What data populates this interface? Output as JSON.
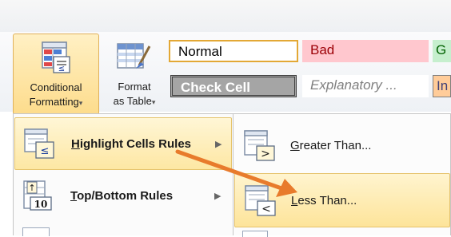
{
  "ribbon": {
    "conditional_formatting": {
      "label_line1": "Conditional",
      "label_line2": "Formatting",
      "dropdown_glyph": "▾",
      "icon": "conditional-formatting-icon"
    },
    "format_as_table": {
      "label_line1": "Format",
      "label_line2": "as Table",
      "dropdown_glyph": "▾",
      "icon": "format-as-table-icon"
    },
    "cell_styles": [
      {
        "name": "normal",
        "label": "Normal",
        "bg": "#ffffff",
        "fg": "#000000",
        "border": "#e3a835"
      },
      {
        "name": "bad",
        "label": "Bad",
        "bg": "#ffc7ce",
        "fg": "#9c0006"
      },
      {
        "name": "good",
        "label": "G",
        "bg": "#c6efce",
        "fg": "#006100"
      },
      {
        "name": "check-cell",
        "label": "Check Cell",
        "bg": "#a5a5a5",
        "fg": "#ffffff",
        "border": "#3f3f3f"
      },
      {
        "name": "explanatory",
        "label": "Explanatory ...",
        "bg": "#ffffff",
        "fg": "#7f7f7f"
      },
      {
        "name": "input",
        "label": "In",
        "bg": "#ffcc99",
        "fg": "#3f3f76"
      }
    ]
  },
  "menu": {
    "items": [
      {
        "accel": "H",
        "rest": "ighlight Cells Rules",
        "arrow": "▶",
        "icon": "highlight-cells-rules-icon"
      },
      {
        "accel": "T",
        "rest": "op/Bottom Rules",
        "arrow": "▶",
        "icon": "top-bottom-rules-icon"
      }
    ]
  },
  "submenu": {
    "items": [
      {
        "accel": "G",
        "rest": "reater Than...",
        "icon": "greater-than-icon"
      },
      {
        "accel": "L",
        "rest": "ess Than...",
        "icon": "less-than-icon"
      }
    ]
  },
  "icon_text": {
    "less_equal": "≤",
    "ten": "10",
    "up_arrow": "↑",
    "greater": ">",
    "less": "<"
  },
  "colors": {
    "highlight": "#fde7a3",
    "arrow": "#e87b2c"
  }
}
